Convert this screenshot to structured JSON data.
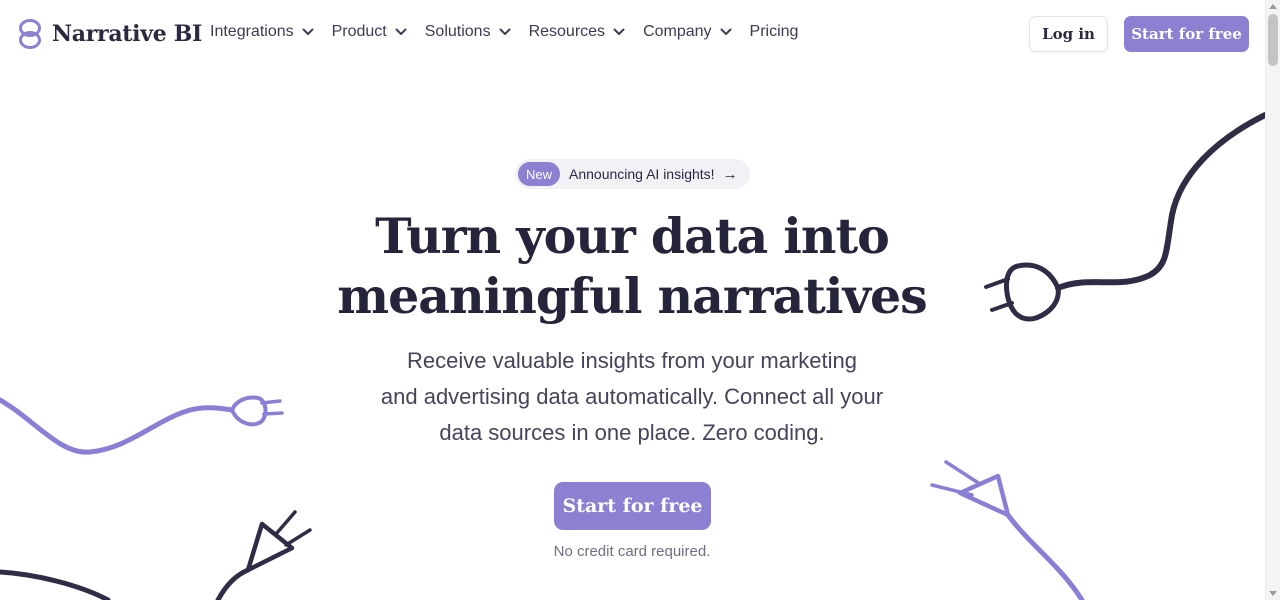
{
  "header": {
    "logo_text": "Narrative BI",
    "nav": [
      {
        "label": "Integrations",
        "has_dropdown": true
      },
      {
        "label": "Product",
        "has_dropdown": true
      },
      {
        "label": "Solutions",
        "has_dropdown": true
      },
      {
        "label": "Resources",
        "has_dropdown": true
      },
      {
        "label": "Company",
        "has_dropdown": true
      },
      {
        "label": "Pricing",
        "has_dropdown": false
      }
    ],
    "login_label": "Log in",
    "start_label": "Start for free"
  },
  "hero": {
    "badge": "New",
    "announcement": "Announcing AI insights!",
    "announcement_arrow": "→",
    "headline_line1": "Turn your data into",
    "headline_line2": "meaningful narratives",
    "subtext_line1": "Receive valuable insights from your marketing",
    "subtext_line2": "and advertising data automatically. Connect all your",
    "subtext_line3": "data sources in one place. Zero coding.",
    "cta_label": "Start for free",
    "note": "No credit card required."
  },
  "colors": {
    "accent": "#8b80d1",
    "dark": "#2a2940",
    "plug_purple": "#8a7fd6",
    "plug_dark": "#2e2d45"
  },
  "icons": [
    "narrative-bi-logo-icon",
    "chevron-down-icon",
    "arrow-right-icon",
    "plug-illustration"
  ]
}
